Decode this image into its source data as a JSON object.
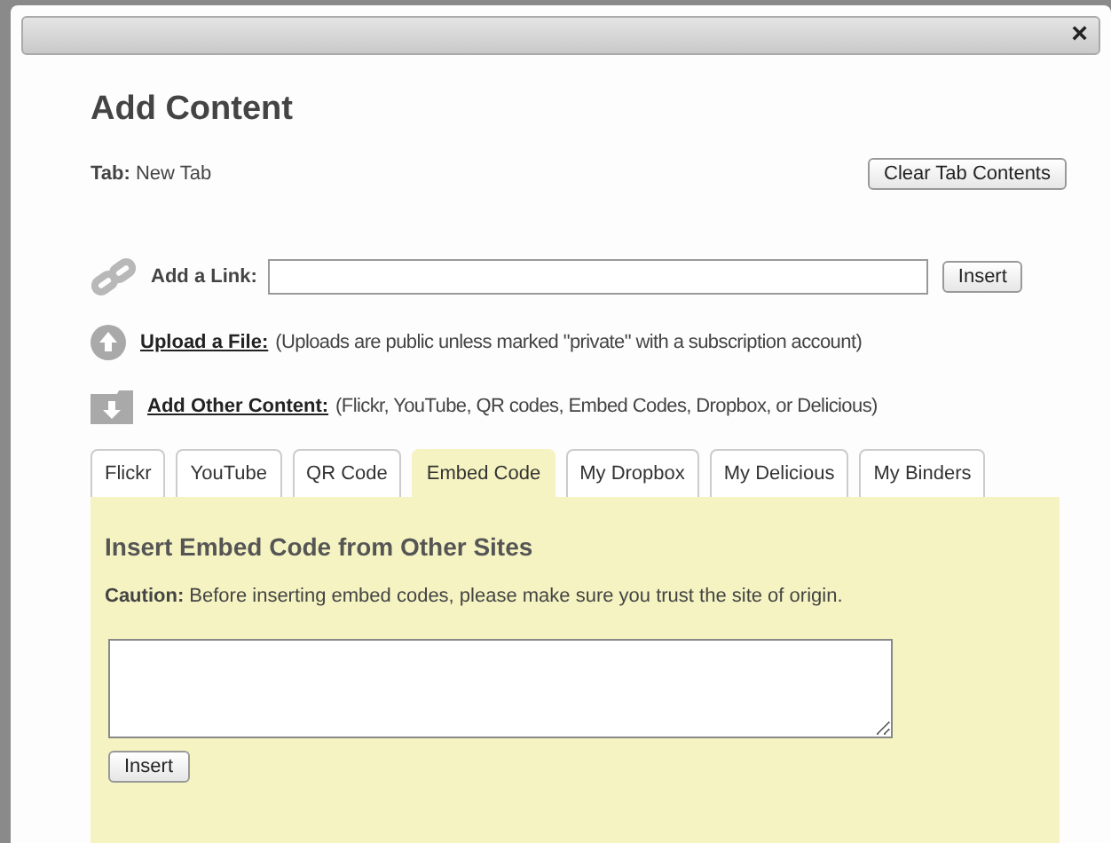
{
  "window": {
    "close": "×"
  },
  "title": "Add Content",
  "tab_info": {
    "label": "Tab:",
    "value": "New Tab"
  },
  "clear_button": "Clear Tab Contents",
  "link": {
    "label": "Add a Link:",
    "button": "Insert"
  },
  "upload": {
    "label": "Upload a File:",
    "note": "(Uploads are public unless marked \"private\" with a subscription account)"
  },
  "other": {
    "label": "Add Other Content:",
    "note": "(Flickr, YouTube, QR codes, Embed Codes, Dropbox, or Delicious)"
  },
  "tabs": [
    {
      "label": "Flickr",
      "selected": false
    },
    {
      "label": "YouTube",
      "selected": false
    },
    {
      "label": "QR Code",
      "selected": false
    },
    {
      "label": "Embed Code",
      "selected": true
    },
    {
      "label": "My Dropbox",
      "selected": false
    },
    {
      "label": "My Delicious",
      "selected": false
    },
    {
      "label": "My Binders",
      "selected": false
    }
  ],
  "panel": {
    "heading": "Insert Embed Code from Other Sites",
    "caution": "**Caution:** Before inserting embed codes, please make sure you trust the site of origin.",
    "button": "Insert"
  }
}
